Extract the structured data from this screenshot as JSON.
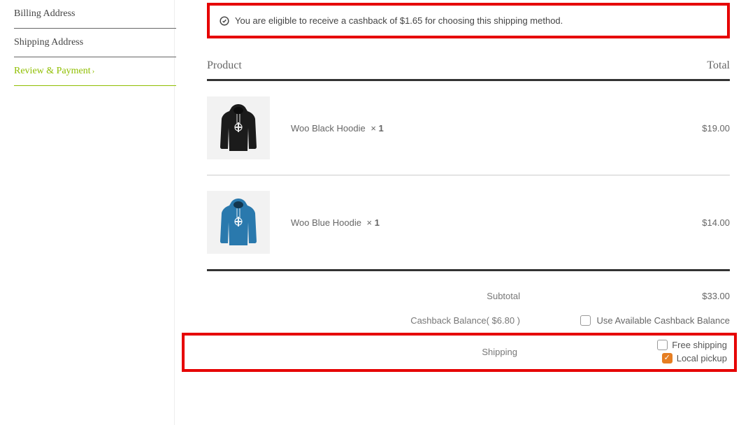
{
  "sidebar": {
    "items": [
      {
        "label": "Billing Address",
        "active": false
      },
      {
        "label": "Shipping Address",
        "active": false
      },
      {
        "label": "Review & Payment",
        "active": true
      }
    ]
  },
  "notice": {
    "text": "You are eligible to receive a cashback of $1.65 for choosing this shipping method."
  },
  "table": {
    "head_product": "Product",
    "head_total": "Total",
    "items": [
      {
        "name": "Woo Black Hoodie",
        "qty_x": "×",
        "qty_n": "1",
        "price": "$19.00",
        "hoodie_color": "#1b1b1b"
      },
      {
        "name": "Woo Blue Hoodie",
        "qty_x": "×",
        "qty_n": "1",
        "price": "$14.00",
        "hoodie_color": "#2a79ad"
      }
    ]
  },
  "totals": {
    "subtotal_label": "Subtotal",
    "subtotal_value": "$33.00",
    "cashback_label": "Cashback  Balance( $6.80 )",
    "cashback_checkbox_label": "Use Available Cashback Balance",
    "cashback_checked": false
  },
  "shipping": {
    "label": "Shipping",
    "options": [
      {
        "label": "Free shipping",
        "checked": false
      },
      {
        "label": "Local pickup",
        "checked": true
      }
    ]
  }
}
